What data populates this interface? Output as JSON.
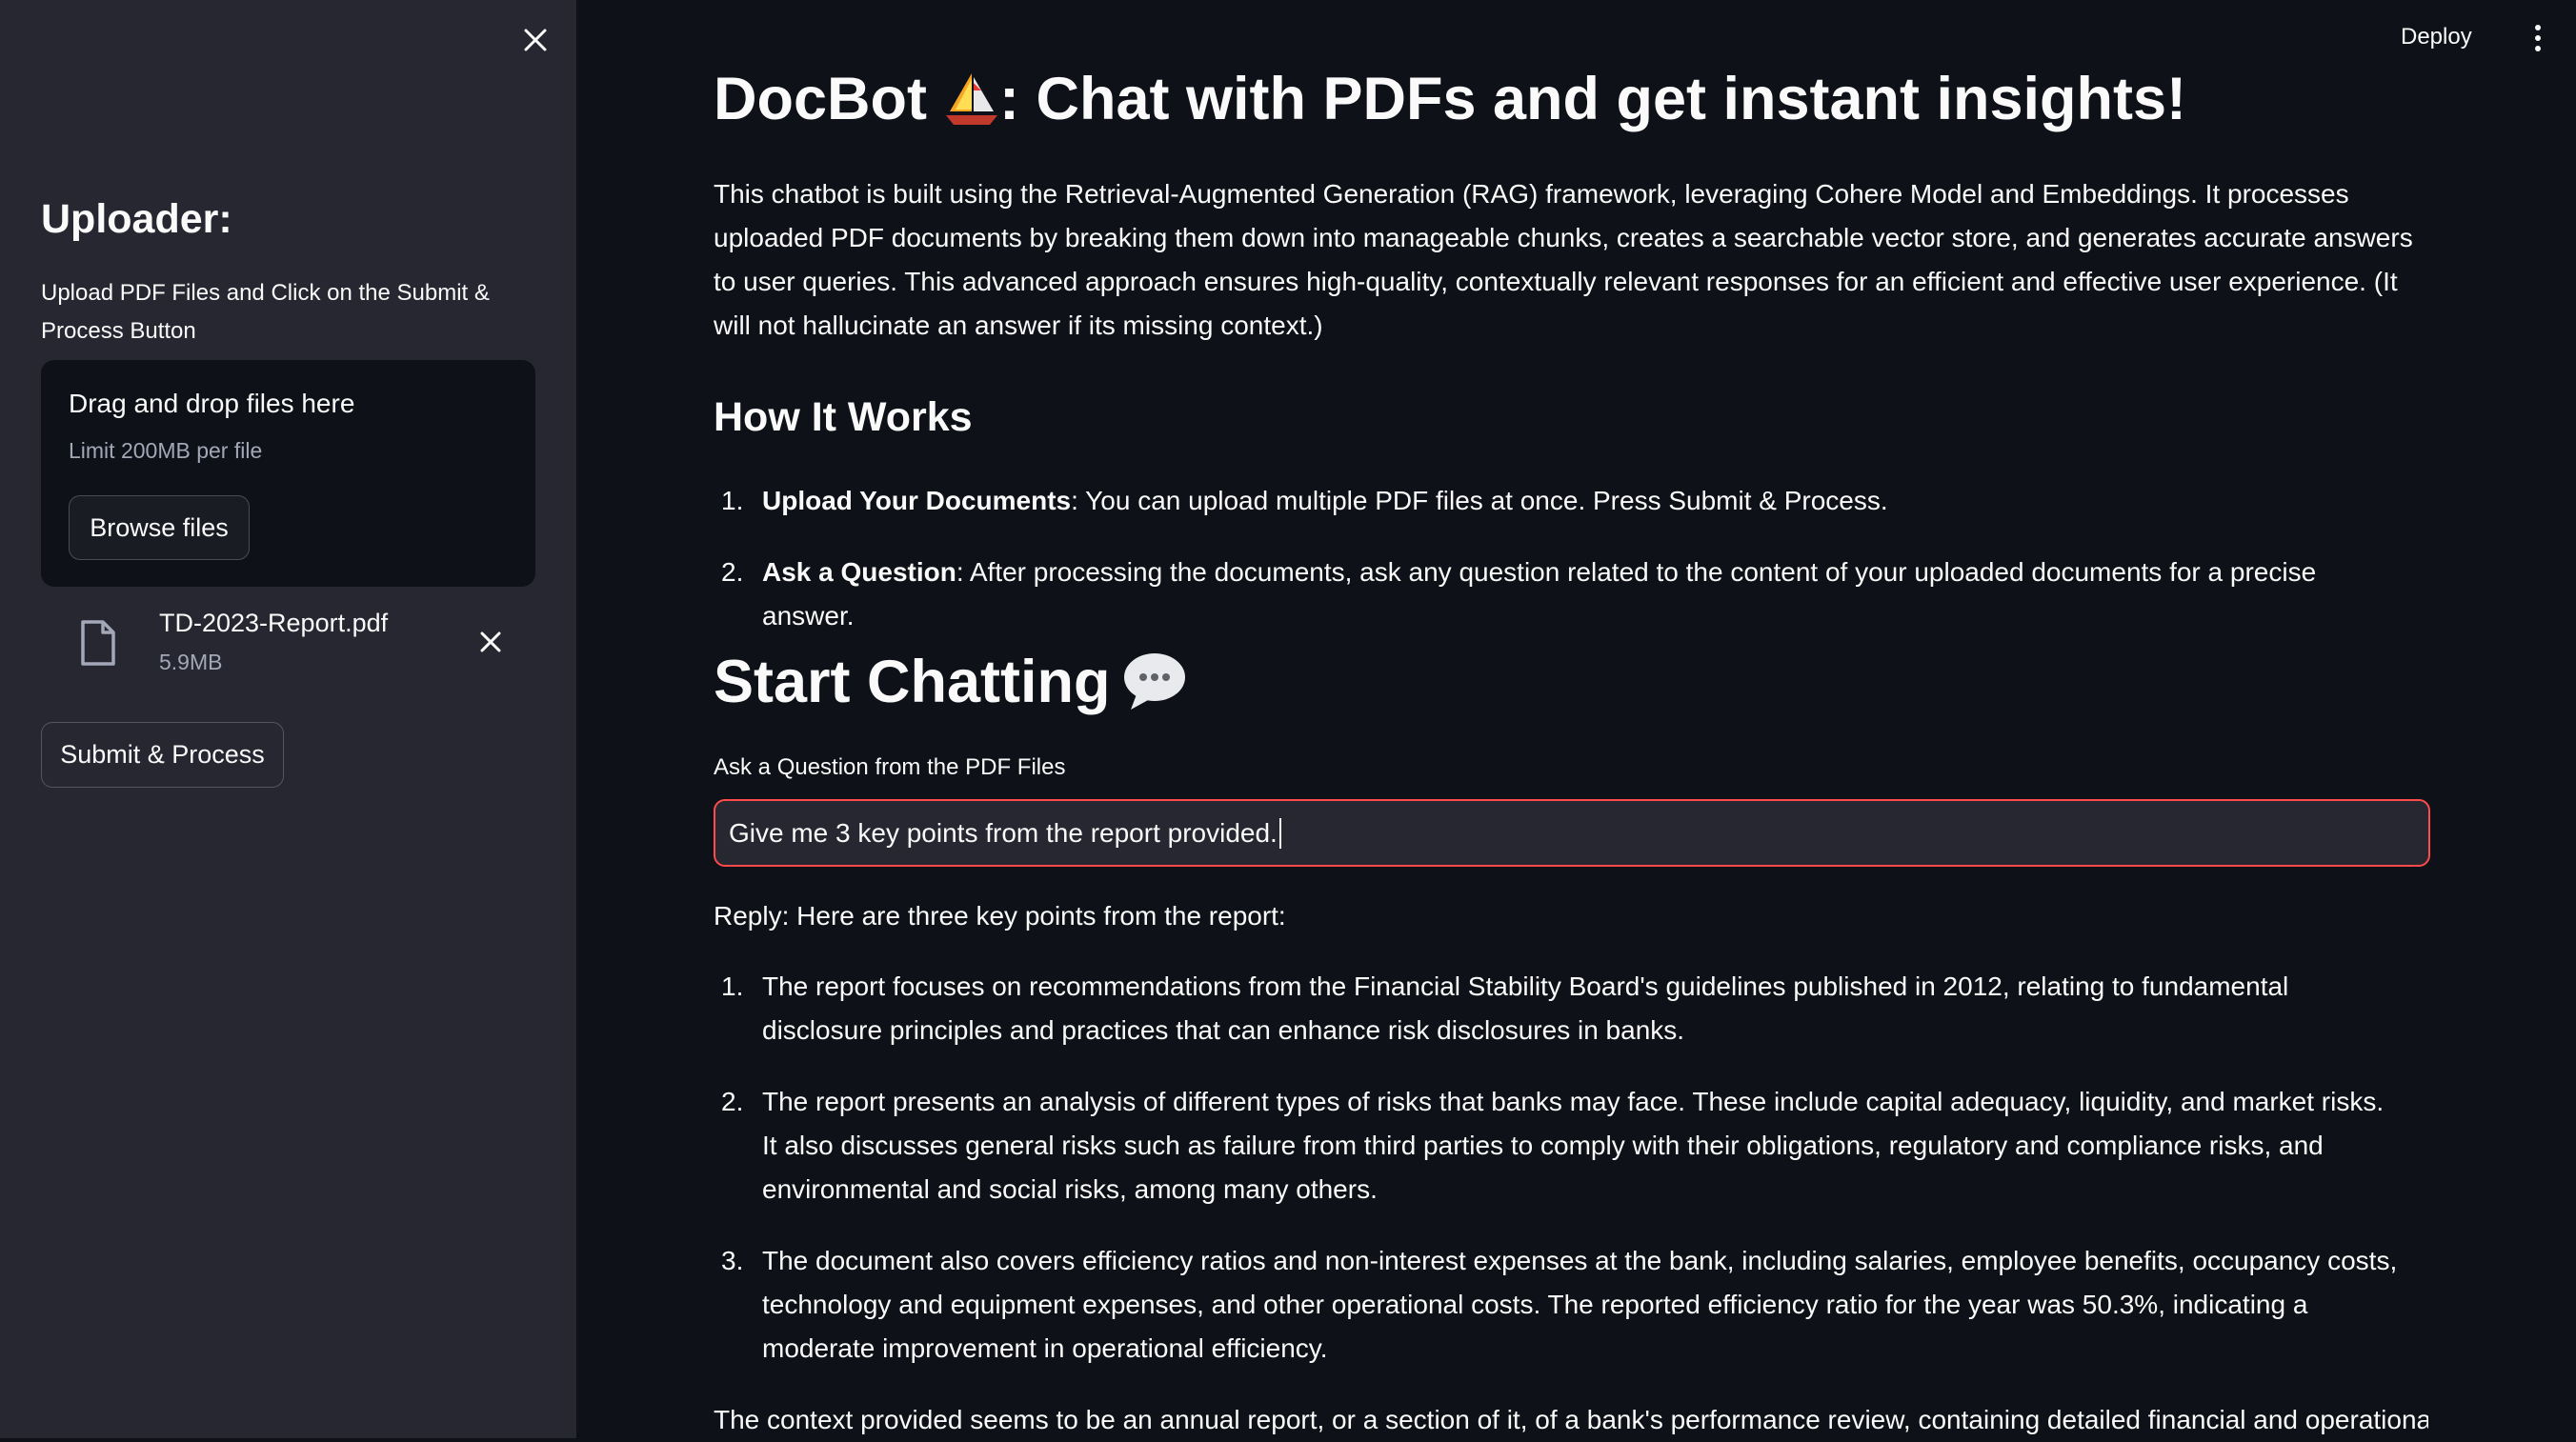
{
  "sidebar": {
    "title": "Uploader:",
    "description": "Upload PDF Files and Click on the Submit & Process Button",
    "dropzone": {
      "title": "Drag and drop files here",
      "limit": "Limit 200MB per file",
      "browse_label": "Browse files"
    },
    "file": {
      "name": "TD-2023-Report.pdf",
      "size": "5.9MB"
    },
    "submit_label": "Submit & Process"
  },
  "header": {
    "deploy_label": "Deploy"
  },
  "main": {
    "title_part1": "DocBot",
    "title_part2": ": Chat with PDFs and get instant insights!",
    "intro": "This chatbot is built using the Retrieval-Augmented Generation (RAG) framework, leveraging Cohere Model and Embeddings. It processes uploaded PDF documents by breaking them down into manageable chunks, creates a searchable vector store, and generates accurate answers to user queries. This advanced approach ensures high-quality, contextually relevant responses for an efficient and effective user experience. (It will not hallucinate an answer if its missing context.)",
    "how_title": "How It Works",
    "how_steps": [
      {
        "num": "1.",
        "bold": "Upload Your Documents",
        "text": ": You can upload multiple PDF files at once. Press Submit & Process."
      },
      {
        "num": "2.",
        "bold": "Ask a Question",
        "text": ": After processing the documents, ask any question related to the content of your uploaded documents for a precise answer."
      }
    ],
    "chat_title": "Start Chatting",
    "question_label": "Ask a Question from the PDF Files",
    "question_value": "Give me 3 key points from the report provided.",
    "reply_intro": "Reply: Here are three key points from the report:",
    "reply_points": [
      {
        "num": "1.",
        "text": "The report focuses on recommendations from the Financial Stability Board's guidelines published in 2012, relating to fundamental disclosure principles and practices that can enhance risk disclosures in banks."
      },
      {
        "num": "2.",
        "text": "The report presents an analysis of different types of risks that banks may face. These include capital adequacy, liquidity, and market risks. It also discusses general risks such as failure from third parties to comply with their obligations, regulatory and compliance risks, and environmental and social risks, among many others."
      },
      {
        "num": "3.",
        "text": "The document also covers efficiency ratios and non-interest expenses at the bank, including salaries, employee benefits, occupancy costs, technology and equipment expenses, and other operational costs. The reported efficiency ratio for the year was 50.3%, indicating a moderate improvement in operational efficiency."
      }
    ],
    "reply_closing": "The context provided seems to be an annual report, or a section of it, of a bank's performance review, containing detailed financial and operational"
  },
  "icons": {
    "close": "close-icon",
    "file": "file-icon",
    "remove": "remove-file-icon",
    "sailboat": "sailboat-icon",
    "speech": "speech-bubble-icon",
    "menu": "kebab-menu-icon"
  },
  "colors": {
    "background": "#0e1117",
    "sidebar": "#262730",
    "accent": "#ff4b4b",
    "text": "#fafafa"
  }
}
